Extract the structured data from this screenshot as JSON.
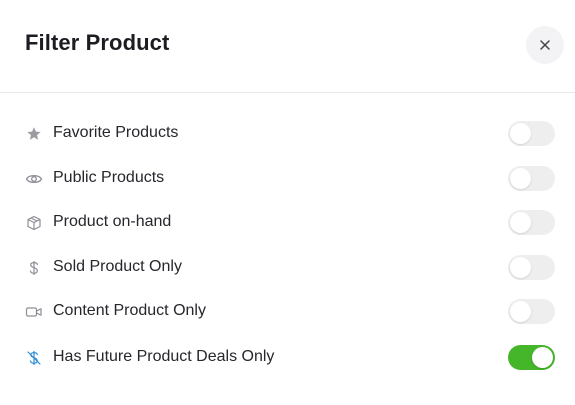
{
  "dialog": {
    "title": "Filter Product",
    "close_icon": "close-icon"
  },
  "filters": [
    {
      "label": "Favorite Products",
      "icon": "star-icon",
      "enabled": false
    },
    {
      "label": "Public Products",
      "icon": "eye-icon",
      "enabled": false
    },
    {
      "label": "Product on-hand",
      "icon": "box-icon",
      "enabled": false
    },
    {
      "label": "Sold Product Only",
      "icon": "dollar-icon",
      "enabled": false
    },
    {
      "label": "Content Product Only",
      "icon": "video-icon",
      "enabled": false
    },
    {
      "label": "Has Future Product Deals Only",
      "icon": "dollar-slash-icon",
      "enabled": true
    }
  ],
  "colors": {
    "toggle_on": "#45b52a",
    "toggle_off": "#eeeeef",
    "accent_icon": "#2f8fd6"
  }
}
